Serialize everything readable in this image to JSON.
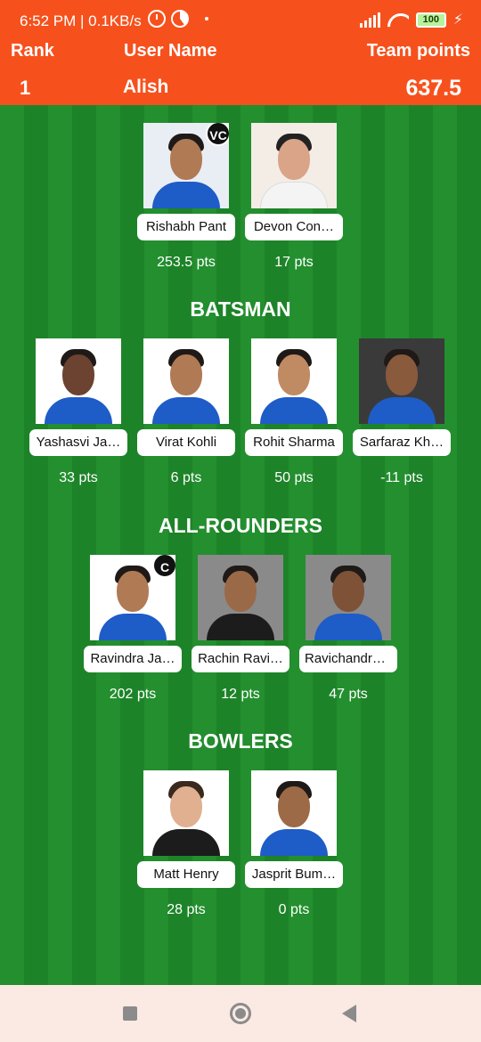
{
  "status": {
    "time": "6:52 PM | 0.1KB/s",
    "battery": "100"
  },
  "header": {
    "rank_label": "Rank",
    "user_label": "User Name",
    "points_label": "Team points",
    "rank": "1",
    "user": "Alish",
    "points": "637.5"
  },
  "wicketkeepers": [
    {
      "name": "Rishabh Pant",
      "pts": "253.5 pts",
      "badge": "VC"
    },
    {
      "name": "Devon Con…",
      "pts": "17 pts"
    }
  ],
  "batsman": {
    "title": "BATSMAN",
    "players": [
      {
        "name": "Yashasvi Ja…",
        "pts": "33 pts"
      },
      {
        "name": "Virat Kohli",
        "pts": "6 pts"
      },
      {
        "name": "Rohit Sharma",
        "pts": "50 pts"
      },
      {
        "name": "Sarfaraz Kh…",
        "pts": "-11 pts"
      }
    ]
  },
  "allrounders": {
    "title": "ALL-ROUNDERS",
    "players": [
      {
        "name": "Ravindra Ja…",
        "pts": "202 pts",
        "badge": "C"
      },
      {
        "name": "Rachin Ravi…",
        "pts": "12 pts"
      },
      {
        "name": "Ravichandra…",
        "pts": "47 pts"
      }
    ]
  },
  "bowlers": {
    "title": "BOWLERS",
    "players": [
      {
        "name": "Matt Henry",
        "pts": "28 pts"
      },
      {
        "name": "Jasprit Bum…",
        "pts": "0 pts"
      }
    ]
  },
  "colors": {
    "header": "#f6511d",
    "field": "#1f8a2c",
    "navbar": "#fbe9e3"
  },
  "icons": [
    "alarm-icon",
    "data-saver-icon",
    "signal-icon",
    "wifi-icon",
    "battery-icon",
    "charging-icon",
    "recents-nav-icon",
    "home-nav-icon",
    "back-nav-icon"
  ]
}
